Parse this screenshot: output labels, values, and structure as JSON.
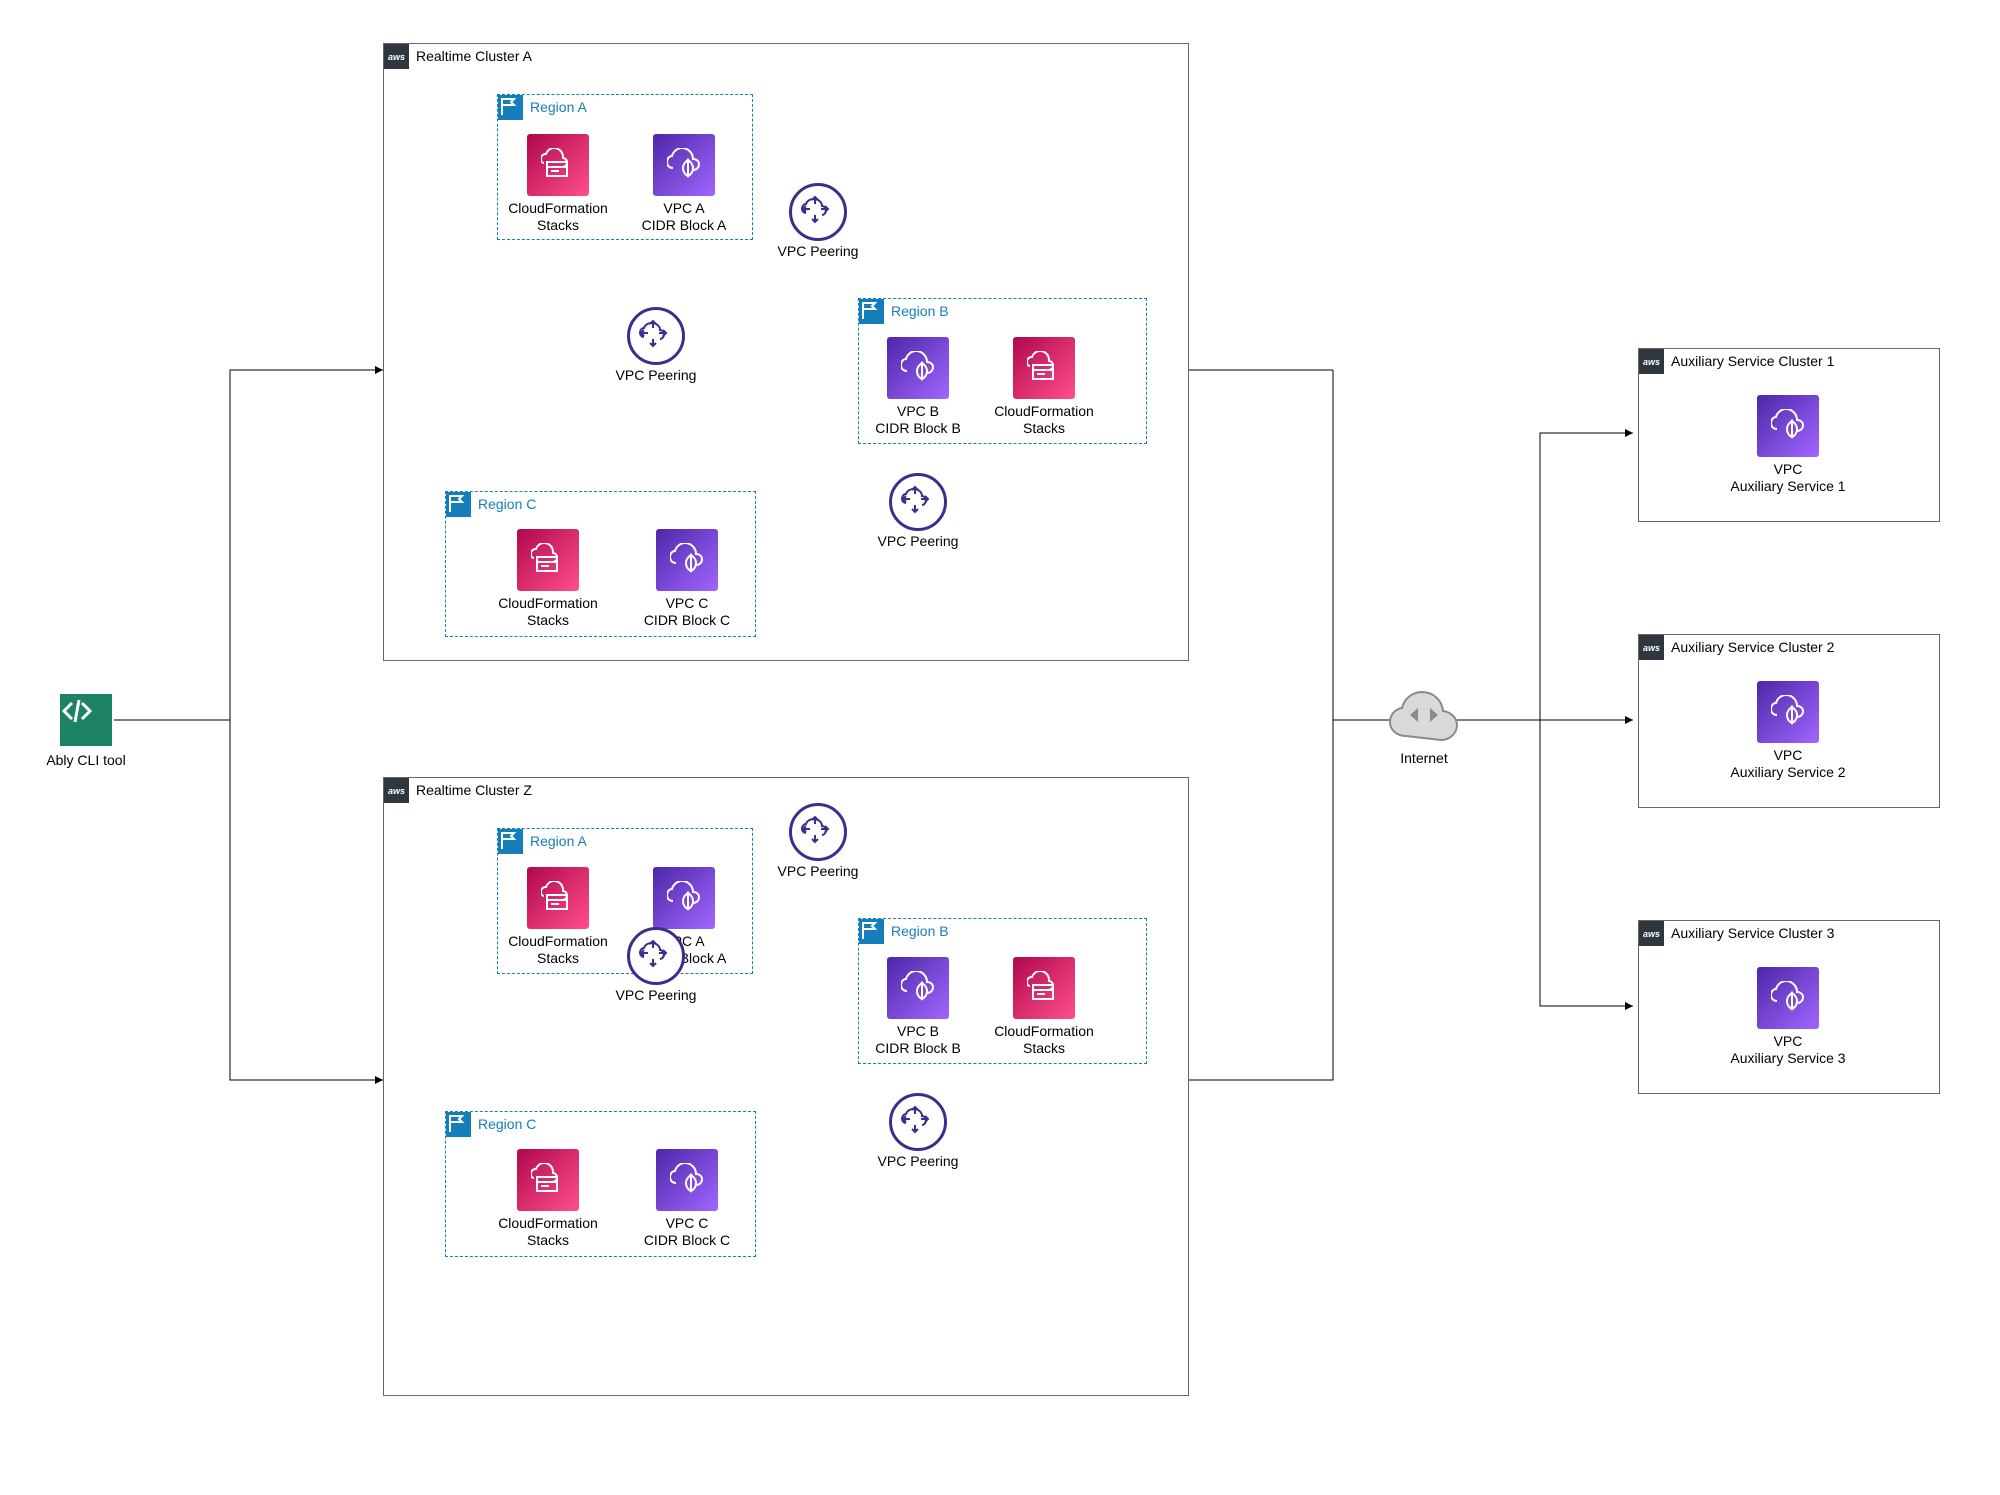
{
  "cli": {
    "label": "Ably CLI tool"
  },
  "clusters": {
    "a": {
      "title": "Realtime Cluster A",
      "regionA": {
        "title": "Region A",
        "cf": "CloudFormation\nStacks",
        "vpc": "VPC A\nCIDR Block A"
      },
      "regionB": {
        "title": "Region B",
        "cf": "CloudFormation\nStacks",
        "vpc": "VPC B\nCIDR Block B"
      },
      "regionC": {
        "title": "Region C",
        "cf": "CloudFormation\nStacks",
        "vpc": "VPC C\nCIDR Block C"
      },
      "peer": "VPC Peering"
    },
    "z": {
      "title": "Realtime Cluster Z",
      "regionA": {
        "title": "Region A",
        "cf": "CloudFormation\nStacks",
        "vpc": "VPC A\nCIDR Block A"
      },
      "regionB": {
        "title": "Region B",
        "cf": "CloudFormation\nStacks",
        "vpc": "VPC B\nCIDR Block B"
      },
      "regionC": {
        "title": "Region C",
        "cf": "CloudFormation\nStacks",
        "vpc": "VPC C\nCIDR Block C"
      },
      "peer": "VPC Peering"
    }
  },
  "internet": {
    "label": "Internet"
  },
  "aux": {
    "c1": {
      "title": "Auxiliary Service Cluster 1",
      "vpc": "VPC\nAuxiliary Service 1"
    },
    "c2": {
      "title": "Auxiliary Service Cluster 2",
      "vpc": "VPC\nAuxiliary Service 2"
    },
    "c3": {
      "title": "Auxiliary Service Cluster 3",
      "vpc": "VPC\nAuxiliary Service 3"
    }
  }
}
